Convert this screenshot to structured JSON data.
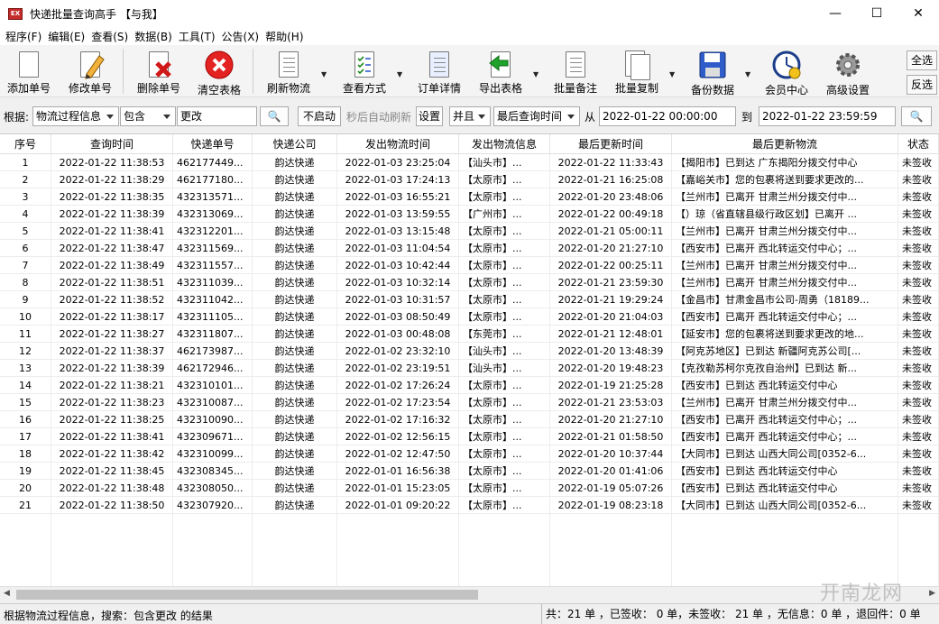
{
  "window": {
    "title": "快递批量查询高手 【与我】",
    "min": "—",
    "max": "☐",
    "close": "✕"
  },
  "menu": [
    "程序(F)",
    "编辑(E)",
    "查看(S)",
    "数据(B)",
    "工具(T)",
    "公告(X)",
    "帮助(H)"
  ],
  "toolbar": {
    "add": "添加单号",
    "edit": "修改单号",
    "delete": "删除单号",
    "clear": "清空表格",
    "refresh": "刷新物流",
    "view": "查看方式",
    "detail": "订单详情",
    "export": "导出表格",
    "batch_note": "批量备注",
    "batch_copy": "批量复制",
    "backup": "备份数据",
    "member": "会员中心",
    "advanced": "高级设置",
    "select_all": "全选",
    "invert": "反选"
  },
  "filter": {
    "by_label": "根据:",
    "field": "物流过程信息",
    "op": "包含",
    "keyword": "更改",
    "search_icon": "🔍",
    "auto_state": "不启动",
    "auto_text": "秒后自动刷新",
    "settings": "设置",
    "logic": "并且",
    "time_field": "最后查询时间",
    "from_label": "从",
    "from_value": "2022-01-22 00:00:00",
    "to_label": "到",
    "to_value": "2022-01-22 23:59:59"
  },
  "table": {
    "columns": [
      "序号",
      "查询时间",
      "快递单号",
      "快递公司",
      "发出物流时间",
      "发出物流信息",
      "最后更新时间",
      "最后更新物流",
      "状态"
    ],
    "rows": [
      [
        "1",
        "2022-01-22 11:38:53",
        "462177449...",
        "韵达快递",
        "2022-01-03 23:25:04",
        "【汕头市】...",
        "2022-01-22 11:33:43",
        "【揭阳市】已到达 广东揭阳分拨交付中心",
        "未签收"
      ],
      [
        "2",
        "2022-01-22 11:38:29",
        "462177180...",
        "韵达快递",
        "2022-01-03 17:24:13",
        "【太原市】...",
        "2022-01-21 16:25:08",
        "【嘉峪关市】您的包裹将送到要求更改的...",
        "未签收"
      ],
      [
        "3",
        "2022-01-22 11:38:35",
        "432313571...",
        "韵达快递",
        "2022-01-03 16:55:21",
        "【太原市】...",
        "2022-01-20 23:48:06",
        "【兰州市】已离开 甘肃兰州分拨交付中...",
        "未签收"
      ],
      [
        "4",
        "2022-01-22 11:38:39",
        "432313069...",
        "韵达快递",
        "2022-01-03 13:59:55",
        "【广州市】...",
        "2022-01-22 00:49:18",
        "【）琼（省直辖县级行政区划】已离开 ...",
        "未签收"
      ],
      [
        "5",
        "2022-01-22 11:38:41",
        "432312201...",
        "韵达快递",
        "2022-01-03 13:15:48",
        "【太原市】...",
        "2022-01-21 05:00:11",
        "【兰州市】已离开 甘肃兰州分拨交付中...",
        "未签收"
      ],
      [
        "6",
        "2022-01-22 11:38:47",
        "432311569...",
        "韵达快递",
        "2022-01-03 11:04:54",
        "【太原市】...",
        "2022-01-20 21:27:10",
        "【西安市】已离开 西北转运交付中心；...",
        "未签收"
      ],
      [
        "7",
        "2022-01-22 11:38:49",
        "432311557...",
        "韵达快递",
        "2022-01-03 10:42:44",
        "【太原市】...",
        "2022-01-22 00:25:11",
        "【兰州市】已离开 甘肃兰州分拨交付中...",
        "未签收"
      ],
      [
        "8",
        "2022-01-22 11:38:51",
        "432311039...",
        "韵达快递",
        "2022-01-03 10:32:14",
        "【太原市】...",
        "2022-01-21 23:59:30",
        "【兰州市】已离开 甘肃兰州分拨交付中...",
        "未签收"
      ],
      [
        "9",
        "2022-01-22 11:38:52",
        "432311042...",
        "韵达快递",
        "2022-01-03 10:31:57",
        "【太原市】...",
        "2022-01-21 19:29:24",
        "【金昌市】甘肃金昌市公司-周勇（18189...",
        "未签收"
      ],
      [
        "10",
        "2022-01-22 11:38:17",
        "432311105...",
        "韵达快递",
        "2022-01-03 08:50:49",
        "【太原市】...",
        "2022-01-20 21:04:03",
        "【西安市】已离开 西北转运交付中心；...",
        "未签收"
      ],
      [
        "11",
        "2022-01-22 11:38:27",
        "432311807...",
        "韵达快递",
        "2022-01-03 00:48:08",
        "【东莞市】...",
        "2022-01-21 12:48:01",
        "【延安市】您的包裹将送到要求更改的地...",
        "未签收"
      ],
      [
        "12",
        "2022-01-22 11:38:37",
        "462173987...",
        "韵达快递",
        "2022-01-02 23:32:10",
        "【汕头市】...",
        "2022-01-20 13:48:39",
        "【阿克苏地区】已到达 新疆阿克苏公司[...",
        "未签收"
      ],
      [
        "13",
        "2022-01-22 11:38:39",
        "462172946...",
        "韵达快递",
        "2022-01-02 23:19:51",
        "【汕头市】...",
        "2022-01-20 19:48:23",
        "【克孜勒苏柯尔克孜自治州】已到达 新...",
        "未签收"
      ],
      [
        "14",
        "2022-01-22 11:38:21",
        "432310101...",
        "韵达快递",
        "2022-01-02 17:26:24",
        "【太原市】...",
        "2022-01-19 21:25:28",
        "【西安市】已到达 西北转运交付中心",
        "未签收"
      ],
      [
        "15",
        "2022-01-22 11:38:23",
        "432310087...",
        "韵达快递",
        "2022-01-02 17:23:54",
        "【太原市】...",
        "2022-01-21 23:53:03",
        "【兰州市】已离开 甘肃兰州分拨交付中...",
        "未签收"
      ],
      [
        "16",
        "2022-01-22 11:38:25",
        "432310090...",
        "韵达快递",
        "2022-01-02 17:16:32",
        "【太原市】...",
        "2022-01-20 21:27:10",
        "【西安市】已离开 西北转运交付中心；...",
        "未签收"
      ],
      [
        "17",
        "2022-01-22 11:38:41",
        "432309671...",
        "韵达快递",
        "2022-01-02 12:56:15",
        "【太原市】...",
        "2022-01-21 01:58:50",
        "【西安市】已离开 西北转运交付中心；...",
        "未签收"
      ],
      [
        "18",
        "2022-01-22 11:38:42",
        "432310099...",
        "韵达快递",
        "2022-01-02 12:47:50",
        "【太原市】...",
        "2022-01-20 10:37:44",
        "【大同市】已到达 山西大同公司[0352-6...",
        "未签收"
      ],
      [
        "19",
        "2022-01-22 11:38:45",
        "432308345...",
        "韵达快递",
        "2022-01-01 16:56:38",
        "【太原市】...",
        "2022-01-20 01:41:06",
        "【西安市】已到达 西北转运交付中心",
        "未签收"
      ],
      [
        "20",
        "2022-01-22 11:38:48",
        "432308050...",
        "韵达快递",
        "2022-01-01 15:23:05",
        "【太原市】...",
        "2022-01-19 05:07:26",
        "【西安市】已到达 西北转运交付中心",
        "未签收"
      ],
      [
        "21",
        "2022-01-22 11:38:50",
        "432307920...",
        "韵达快递",
        "2022-01-01 09:20:22",
        "【太原市】...",
        "2022-01-19 08:23:18",
        "【大同市】已到达 山西大同公司[0352-6...",
        "未签收"
      ]
    ]
  },
  "status": {
    "left": "根据物流过程信息，搜索：包含更改 的结果",
    "right": "共：21 单 ，已签收： 0 单，未签收： 21 单 ，无信息：0 单 ，退回件：0 单"
  },
  "watermark": "开南龙网"
}
